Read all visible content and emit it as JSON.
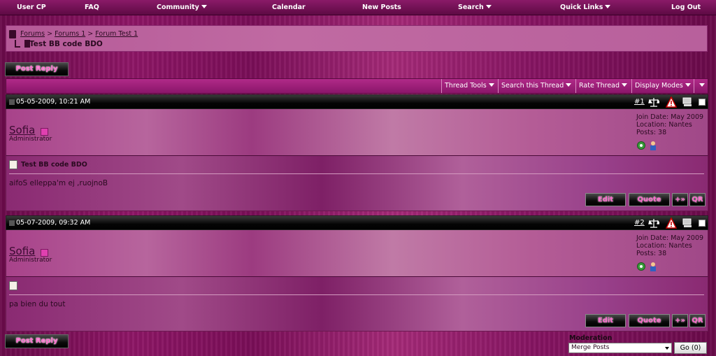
{
  "nav": {
    "user_cp": "User CP",
    "faq": "FAQ",
    "community": "Community",
    "calendar": "Calendar",
    "new_posts": "New Posts",
    "search": "Search",
    "quick_links": "Quick Links",
    "log_out": "Log Out"
  },
  "breadcrumb": {
    "forums": "Forums",
    "forums1": "Forums 1",
    "forum_test": "Forum Test 1",
    "sep": ">",
    "thread_title": "Test BB code BDO"
  },
  "buttons": {
    "post_reply": "Post Reply",
    "edit": "Edit",
    "quote": "Quote",
    "multiquote": "+»",
    "qr": "QR",
    "go": "Go (0)"
  },
  "tools": {
    "thread_tools": "Thread Tools",
    "search_thread": "Search this Thread",
    "rate_thread": "Rate Thread",
    "display_modes": "Display Modes"
  },
  "posts": [
    {
      "date": "05-05-2009, 10:21 AM",
      "number": "#1",
      "username": "Sofia",
      "user_title": "Administrator",
      "join_date": "Join Date: May 2009",
      "location": "Location: Nantes",
      "posts": "Posts: 38",
      "title": "Test BB code BDO",
      "body": "aifoS elleppa'm ej ,ruojnoB"
    },
    {
      "date": "05-07-2009, 09:32 AM",
      "number": "#2",
      "username": "Sofia",
      "user_title": "Administrator",
      "join_date": "Join Date: May 2009",
      "location": "Location: Nantes",
      "posts": "Posts: 38",
      "title": "",
      "body": "pa bien du tout"
    }
  ],
  "moderation": {
    "label": "Moderation",
    "selected": "Merge Posts"
  },
  "colors": {
    "accent": "#ff66cc",
    "online": "#e040b0"
  }
}
